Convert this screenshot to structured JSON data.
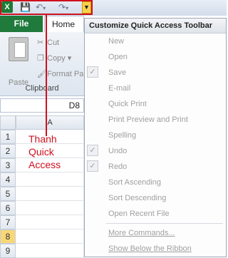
{
  "qat": {
    "app_logo": "X",
    "save_icon": "save-icon",
    "undo_icon": "undo-icon",
    "redo_icon": "redo-icon",
    "dropdown_glyph": "▼"
  },
  "ribbon": {
    "file_tab": "File",
    "home_tab": "Home",
    "paste_label": "Paste",
    "cut_label": "Cut",
    "copy_label": "Copy ▾",
    "format_painter_label": "Format Pa",
    "group_label": "Clipboard"
  },
  "sheet": {
    "name_box": "D8",
    "column_a": "A",
    "rows": [
      "1",
      "2",
      "3",
      "4",
      "5",
      "6",
      "7",
      "8",
      "9"
    ],
    "active_row": "8"
  },
  "annotation": {
    "text_line1": "Thanh",
    "text_line2": "Quick",
    "text_line3": "Access"
  },
  "menu": {
    "title": "Customize Quick Access Toolbar",
    "items": [
      {
        "label": "New",
        "checked": false
      },
      {
        "label": "Open",
        "checked": false
      },
      {
        "label": "Save",
        "checked": true
      },
      {
        "label": "E-mail",
        "checked": false
      },
      {
        "label": "Quick Print",
        "checked": false
      },
      {
        "label": "Print Preview and Print",
        "checked": false
      },
      {
        "label": "Spelling",
        "checked": false
      },
      {
        "label": "Undo",
        "checked": true
      },
      {
        "label": "Redo",
        "checked": true
      },
      {
        "label": "Sort Ascending",
        "checked": false
      },
      {
        "label": "Sort Descending",
        "checked": false
      },
      {
        "label": "Open Recent File",
        "checked": false
      }
    ],
    "more_commands": "More Commands...",
    "show_below": "Show Below the Ribbon"
  }
}
